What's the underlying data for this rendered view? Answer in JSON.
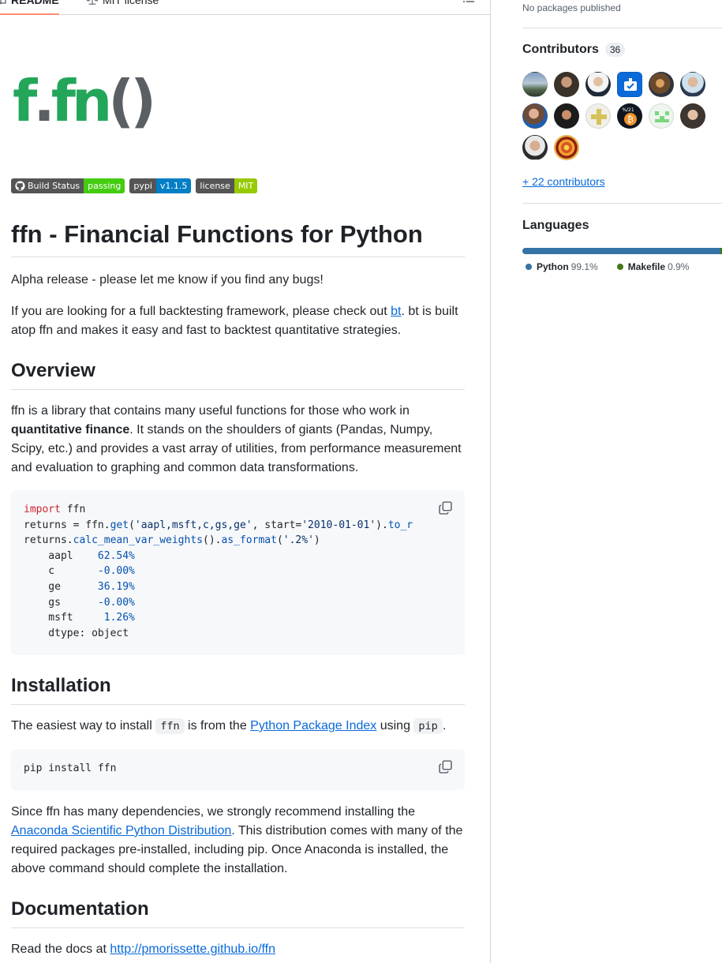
{
  "tabs": {
    "readme": "README",
    "license": "MIT license"
  },
  "logo": {
    "f1": "f",
    "dot": ".",
    "fn": "fn",
    "parens": "()"
  },
  "badges": [
    {
      "label": "Build Status",
      "value": "passing",
      "color": "#44cc11"
    },
    {
      "label": "pypi",
      "value": "v1.1.5",
      "color": "#007ec6"
    },
    {
      "label": "license",
      "value": "MIT",
      "color": "#97ca00"
    }
  ],
  "readme": {
    "title": "ffn - Financial Functions for Python",
    "alpha": "Alpha release - please let me know if you find any bugs!",
    "bt_pre": "If you are looking for a full backtesting framework, please check out ",
    "bt_link": "bt",
    "bt_post": ". bt is built atop ffn and makes it easy and fast to backtest quantitative strategies.",
    "overview_heading": "Overview",
    "overview_pre": "ffn is a library that contains many useful functions for those who work in ",
    "overview_bold": "quantitative finance",
    "overview_post": ". It stands on the shoulders of giants (Pandas, Numpy, Scipy, etc.) and provides a vast array of utilities, from performance measurement and evaluation to graphing and common data transformations.",
    "code1": {
      "kw_import": "import",
      "mod": " ffn",
      "l2_a": "returns = ffn.",
      "l2_get": "get",
      "l2_b": "(",
      "l2_str1": "'aapl,msft,c,gs,ge'",
      "l2_c": ", start=",
      "l2_str2": "'2010-01-01'",
      "l2_d": ").",
      "l2_tor": "to_r",
      "l3_a": "returns.",
      "l3_fn1": "calc_mean_var_weights",
      "l3_b": "().",
      "l3_fn2": "as_format",
      "l3_c": "(",
      "l3_str": "'.2%'",
      "l3_d": ")",
      "rows": [
        {
          "name": "    aapl    ",
          "val": "62.54%"
        },
        {
          "name": "    c       ",
          "val": "-0.00%"
        },
        {
          "name": "    ge      ",
          "val": "36.19%"
        },
        {
          "name": "    gs      ",
          "val": "-0.00%"
        },
        {
          "name": "    msft     ",
          "val": "1.26%"
        }
      ],
      "dtype": "    dtype: object"
    },
    "install_heading": "Installation",
    "install_pre": "The easiest way to install ",
    "install_code1": "ffn",
    "install_mid": " is from the ",
    "install_link": "Python Package Index",
    "install_using": " using ",
    "install_code2": "pip",
    "install_end": ".",
    "code2": "pip install ffn",
    "deps_pre": "Since ffn has many dependencies, we strongly recommend installing the ",
    "deps_link": "Anaconda Scientific Python Distribution",
    "deps_post": ". This distribution comes with many of the required packages pre-installed, including pip. Once Anaconda is installed, the above command should complete the installation.",
    "docs_heading": "Documentation",
    "docs_pre": "Read the docs at ",
    "docs_link": "http://pmorissette.github.io/ffn"
  },
  "sidebar": {
    "no_packages": "No packages published",
    "contributors_title": "Contributors",
    "contributors_count": "36",
    "more_contributors": "+ 22 contributors",
    "languages_title": "Languages",
    "languages": [
      {
        "name": "Python",
        "pct": "99.1%",
        "share": 99.1,
        "color": "#3572A5"
      },
      {
        "name": "Makefile",
        "pct": "0.9%",
        "share": 0.9,
        "color": "#427819"
      }
    ]
  }
}
